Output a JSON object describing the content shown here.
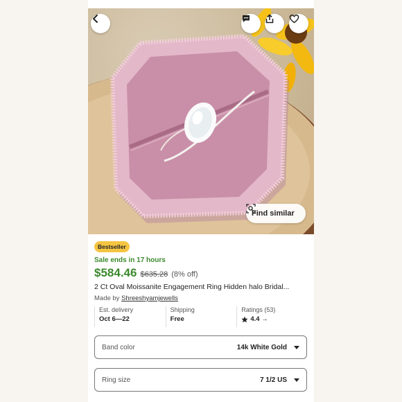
{
  "colors": {
    "accent": "#3c8a2e",
    "badge": "#f5c542"
  },
  "hero": {
    "icons": [
      "back-icon",
      "message-icon",
      "share-icon",
      "heart-icon",
      "camera-search-icon"
    ],
    "find_similar_label": "Find similar"
  },
  "listing": {
    "badge": "Bestseller",
    "sale_text": "Sale ends in 17 hours",
    "price": "$584.46",
    "original_price": "$635.28",
    "discount": "(8% off)",
    "title": "2 Ct Oval Moissanite Engagement Ring Hidden halo Bridal...",
    "made_by_prefix": "Made by ",
    "shop_name": "Shreeshyamjewells"
  },
  "facts": {
    "delivery_label": "Est. delivery",
    "delivery_value": "Oct 6—22",
    "shipping_label": "Shipping",
    "shipping_value": "Free",
    "ratings_label": "Ratings (53)",
    "ratings_value": "4.4 →"
  },
  "options": {
    "band_color_label": "Band color",
    "band_color_value": "14k White Gold",
    "ring_size_label": "Ring size",
    "ring_size_value": "7 1/2 US"
  }
}
